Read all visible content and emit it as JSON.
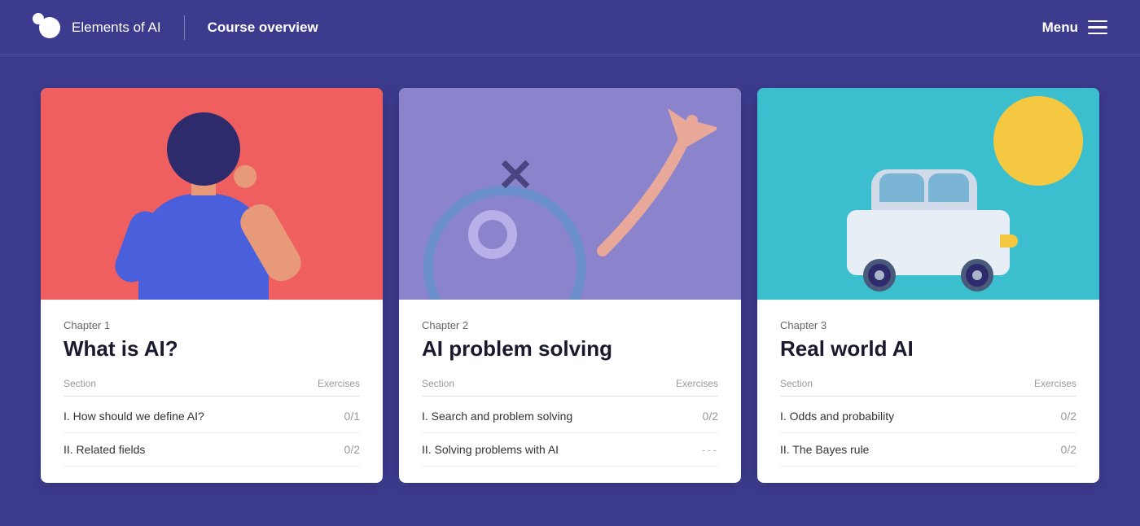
{
  "header": {
    "logo_text": "Elements of AI",
    "course_label": "Course overview",
    "menu_label": "Menu"
  },
  "cards": [
    {
      "chapter_label": "Chapter 1",
      "title": "What is AI?",
      "section_header": "Section",
      "exercises_header": "Exercises",
      "sections": [
        {
          "name": "I. How should we define AI?",
          "exercises": "0/1",
          "locked": false
        },
        {
          "name": "II. Related fields",
          "exercises": "0/2",
          "locked": false
        }
      ]
    },
    {
      "chapter_label": "Chapter 2",
      "title": "AI problem solving",
      "section_header": "Section",
      "exercises_header": "Exercises",
      "sections": [
        {
          "name": "I. Search and problem solving",
          "exercises": "0/2",
          "locked": false
        },
        {
          "name": "II. Solving problems with AI",
          "exercises": "---",
          "locked": true
        }
      ]
    },
    {
      "chapter_label": "Chapter 3",
      "title": "Real world AI",
      "section_header": "Section",
      "exercises_header": "Exercises",
      "sections": [
        {
          "name": "I. Odds and probability",
          "exercises": "0/2",
          "locked": false
        },
        {
          "name": "II. The Bayes rule",
          "exercises": "0/2",
          "locked": false
        }
      ]
    }
  ]
}
